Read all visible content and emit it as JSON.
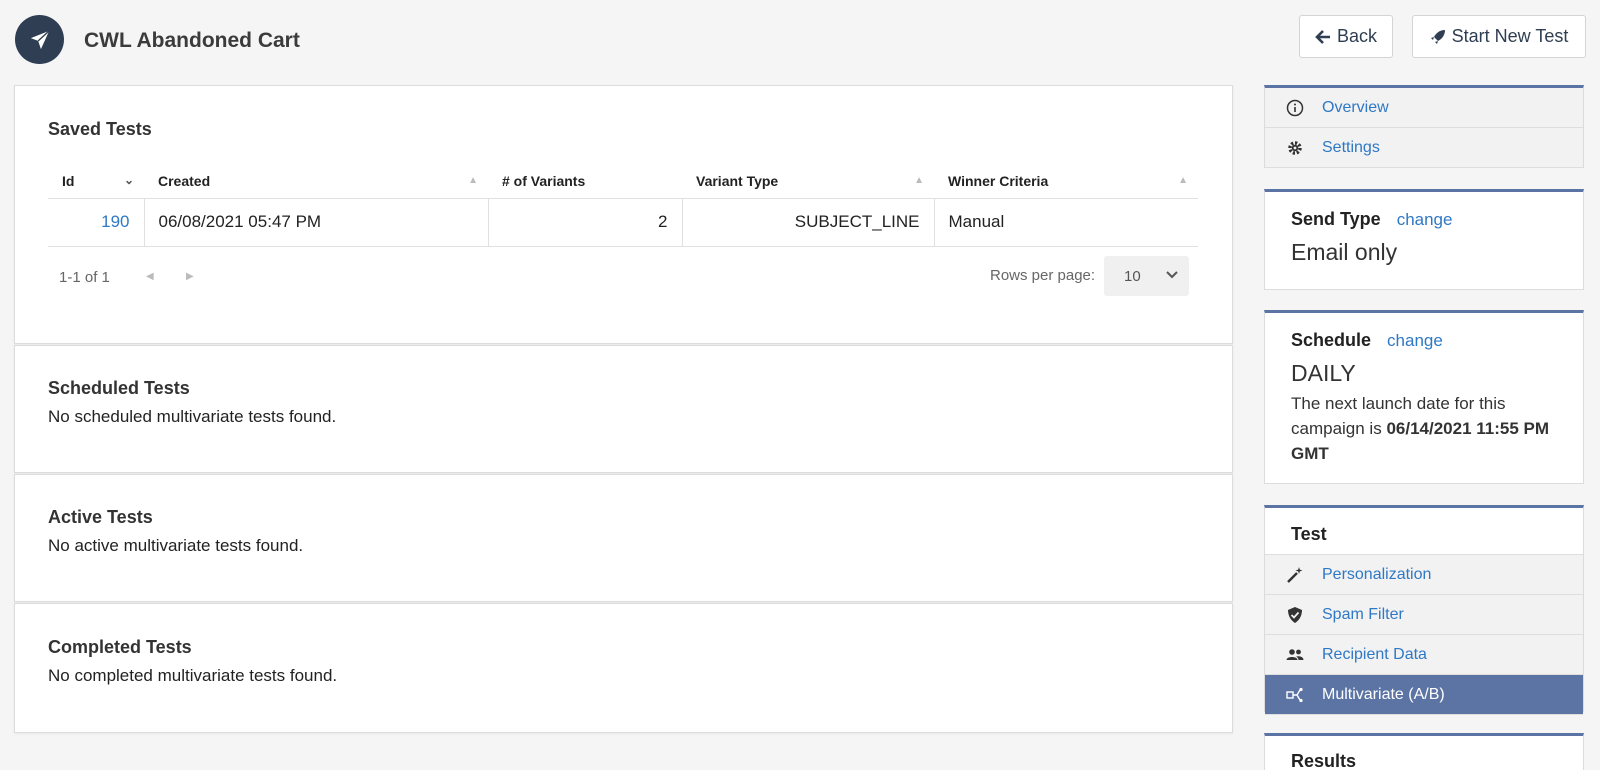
{
  "header": {
    "title": "CWL Abandoned Cart",
    "back_label": "Back",
    "new_test_label": "Start New Test"
  },
  "saved_tests": {
    "title": "Saved Tests",
    "columns": [
      "Id",
      "Created",
      "# of Variants",
      "Variant Type",
      "Winner Criteria"
    ],
    "rows": [
      {
        "id": "190",
        "created": "06/08/2021 05:47 PM",
        "variants": "2",
        "variant_type": "SUBJECT_LINE",
        "winner": "Manual"
      }
    ],
    "pager_count": "1-1 of 1",
    "rows_per_page_label": "Rows per page:",
    "rows_per_page": "10"
  },
  "scheduled_tests": {
    "title": "Scheduled Tests",
    "message": "No scheduled multivariate tests found."
  },
  "active_tests": {
    "title": "Active Tests",
    "message": "No active multivariate tests found."
  },
  "completed_tests": {
    "title": "Completed Tests",
    "message": "No completed multivariate tests found."
  },
  "sidebar": {
    "nav": [
      {
        "label": "Overview",
        "icon": "info-icon"
      },
      {
        "label": "Settings",
        "icon": "gear-icon"
      }
    ],
    "send_type": {
      "title": "Send Type",
      "change": "change",
      "value": "Email only"
    },
    "schedule": {
      "title": "Schedule",
      "change": "change",
      "value": "DAILY",
      "note_prefix": "The next launch date for this campaign is ",
      "next_date": "06/14/2021 11:55 PM GMT"
    },
    "test": {
      "title": "Test",
      "items": [
        {
          "label": "Personalization",
          "icon": "magic-wand-icon"
        },
        {
          "label": "Spam Filter",
          "icon": "shield-icon"
        },
        {
          "label": "Recipient Data",
          "icon": "people-icon"
        },
        {
          "label": "Multivariate (A/B)",
          "icon": "split-icon",
          "active": true
        }
      ]
    },
    "results": {
      "title": "Results"
    }
  },
  "colors": {
    "accent": "#5c74a3",
    "link": "#2f78c4",
    "logo_bg": "#2f3e52"
  }
}
